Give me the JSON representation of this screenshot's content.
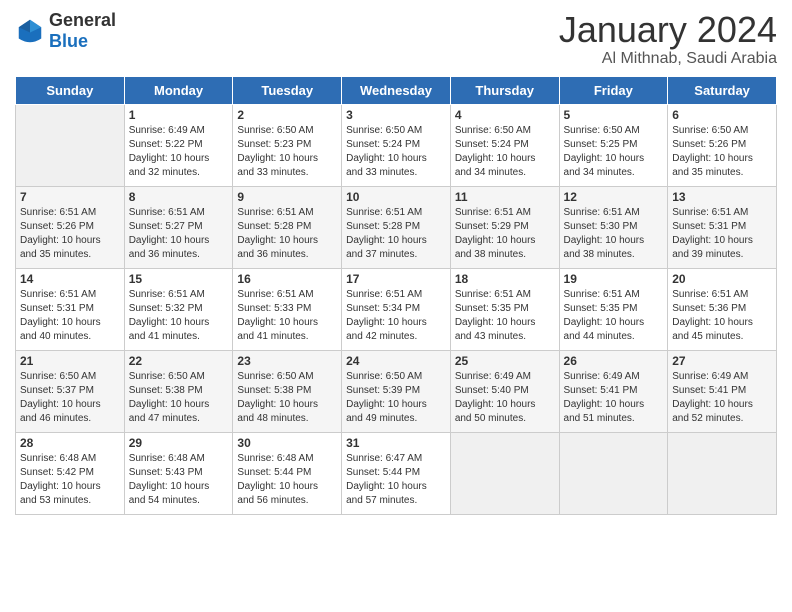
{
  "logo": {
    "general": "General",
    "blue": "Blue"
  },
  "title": "January 2024",
  "subtitle": "Al Mithnab, Saudi Arabia",
  "weekdays": [
    "Sunday",
    "Monday",
    "Tuesday",
    "Wednesday",
    "Thursday",
    "Friday",
    "Saturday"
  ],
  "weeks": [
    [
      {
        "day": "",
        "content": ""
      },
      {
        "day": "1",
        "content": "Sunrise: 6:49 AM\nSunset: 5:22 PM\nDaylight: 10 hours\nand 32 minutes."
      },
      {
        "day": "2",
        "content": "Sunrise: 6:50 AM\nSunset: 5:23 PM\nDaylight: 10 hours\nand 33 minutes."
      },
      {
        "day": "3",
        "content": "Sunrise: 6:50 AM\nSunset: 5:24 PM\nDaylight: 10 hours\nand 33 minutes."
      },
      {
        "day": "4",
        "content": "Sunrise: 6:50 AM\nSunset: 5:24 PM\nDaylight: 10 hours\nand 34 minutes."
      },
      {
        "day": "5",
        "content": "Sunrise: 6:50 AM\nSunset: 5:25 PM\nDaylight: 10 hours\nand 34 minutes."
      },
      {
        "day": "6",
        "content": "Sunrise: 6:50 AM\nSunset: 5:26 PM\nDaylight: 10 hours\nand 35 minutes."
      }
    ],
    [
      {
        "day": "7",
        "content": "Sunrise: 6:51 AM\nSunset: 5:26 PM\nDaylight: 10 hours\nand 35 minutes."
      },
      {
        "day": "8",
        "content": "Sunrise: 6:51 AM\nSunset: 5:27 PM\nDaylight: 10 hours\nand 36 minutes."
      },
      {
        "day": "9",
        "content": "Sunrise: 6:51 AM\nSunset: 5:28 PM\nDaylight: 10 hours\nand 36 minutes."
      },
      {
        "day": "10",
        "content": "Sunrise: 6:51 AM\nSunset: 5:28 PM\nDaylight: 10 hours\nand 37 minutes."
      },
      {
        "day": "11",
        "content": "Sunrise: 6:51 AM\nSunset: 5:29 PM\nDaylight: 10 hours\nand 38 minutes."
      },
      {
        "day": "12",
        "content": "Sunrise: 6:51 AM\nSunset: 5:30 PM\nDaylight: 10 hours\nand 38 minutes."
      },
      {
        "day": "13",
        "content": "Sunrise: 6:51 AM\nSunset: 5:31 PM\nDaylight: 10 hours\nand 39 minutes."
      }
    ],
    [
      {
        "day": "14",
        "content": "Sunrise: 6:51 AM\nSunset: 5:31 PM\nDaylight: 10 hours\nand 40 minutes."
      },
      {
        "day": "15",
        "content": "Sunrise: 6:51 AM\nSunset: 5:32 PM\nDaylight: 10 hours\nand 41 minutes."
      },
      {
        "day": "16",
        "content": "Sunrise: 6:51 AM\nSunset: 5:33 PM\nDaylight: 10 hours\nand 41 minutes."
      },
      {
        "day": "17",
        "content": "Sunrise: 6:51 AM\nSunset: 5:34 PM\nDaylight: 10 hours\nand 42 minutes."
      },
      {
        "day": "18",
        "content": "Sunrise: 6:51 AM\nSunset: 5:35 PM\nDaylight: 10 hours\nand 43 minutes."
      },
      {
        "day": "19",
        "content": "Sunrise: 6:51 AM\nSunset: 5:35 PM\nDaylight: 10 hours\nand 44 minutes."
      },
      {
        "day": "20",
        "content": "Sunrise: 6:51 AM\nSunset: 5:36 PM\nDaylight: 10 hours\nand 45 minutes."
      }
    ],
    [
      {
        "day": "21",
        "content": "Sunrise: 6:50 AM\nSunset: 5:37 PM\nDaylight: 10 hours\nand 46 minutes."
      },
      {
        "day": "22",
        "content": "Sunrise: 6:50 AM\nSunset: 5:38 PM\nDaylight: 10 hours\nand 47 minutes."
      },
      {
        "day": "23",
        "content": "Sunrise: 6:50 AM\nSunset: 5:38 PM\nDaylight: 10 hours\nand 48 minutes."
      },
      {
        "day": "24",
        "content": "Sunrise: 6:50 AM\nSunset: 5:39 PM\nDaylight: 10 hours\nand 49 minutes."
      },
      {
        "day": "25",
        "content": "Sunrise: 6:49 AM\nSunset: 5:40 PM\nDaylight: 10 hours\nand 50 minutes."
      },
      {
        "day": "26",
        "content": "Sunrise: 6:49 AM\nSunset: 5:41 PM\nDaylight: 10 hours\nand 51 minutes."
      },
      {
        "day": "27",
        "content": "Sunrise: 6:49 AM\nSunset: 5:41 PM\nDaylight: 10 hours\nand 52 minutes."
      }
    ],
    [
      {
        "day": "28",
        "content": "Sunrise: 6:48 AM\nSunset: 5:42 PM\nDaylight: 10 hours\nand 53 minutes."
      },
      {
        "day": "29",
        "content": "Sunrise: 6:48 AM\nSunset: 5:43 PM\nDaylight: 10 hours\nand 54 minutes."
      },
      {
        "day": "30",
        "content": "Sunrise: 6:48 AM\nSunset: 5:44 PM\nDaylight: 10 hours\nand 56 minutes."
      },
      {
        "day": "31",
        "content": "Sunrise: 6:47 AM\nSunset: 5:44 PM\nDaylight: 10 hours\nand 57 minutes."
      },
      {
        "day": "",
        "content": ""
      },
      {
        "day": "",
        "content": ""
      },
      {
        "day": "",
        "content": ""
      }
    ]
  ]
}
